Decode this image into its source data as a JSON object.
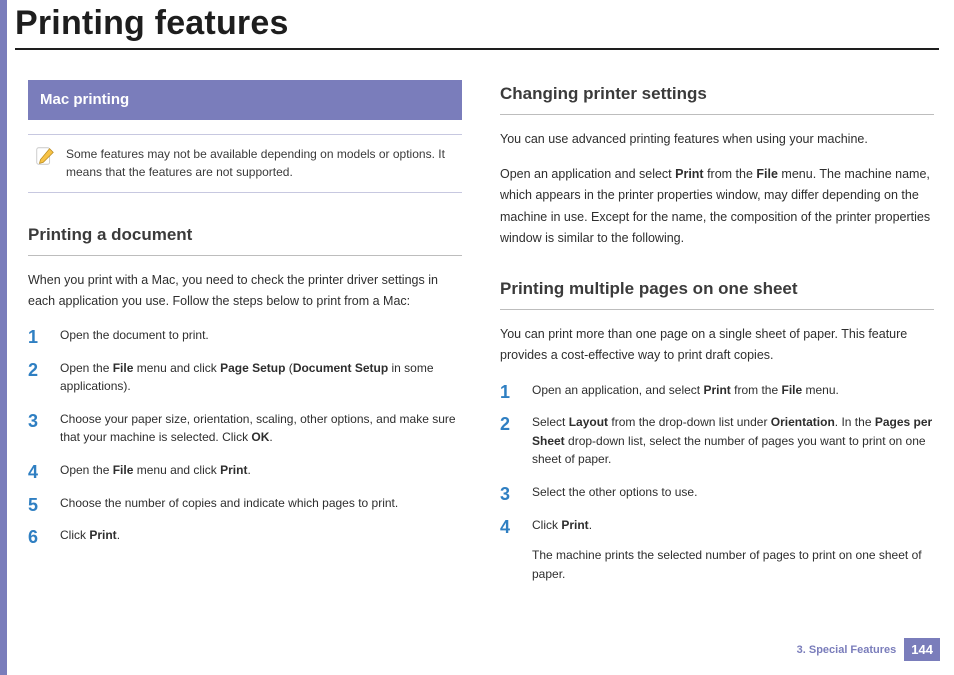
{
  "title": "Printing features",
  "left": {
    "banner": "Mac printing",
    "note": "Some features may not be available depending on models or options. It means that the features are not supported.",
    "subhead": "Printing a document",
    "intro": "When you print with a Mac, you need to check the printer driver settings in each application you use. Follow the steps below to print from a Mac:",
    "steps": {
      "s1": "Open the document to print.",
      "s2_pre": "Open the ",
      "s2_b1": "File",
      "s2_mid": " menu and click ",
      "s2_b2": "Page Setup",
      "s2_paren_open": " (",
      "s2_b3": "Document Setup",
      "s2_tail": " in some applications).",
      "s3_pre": "Choose your paper size, orientation, scaling, other options, and make sure that your machine is selected. Click ",
      "s3_b1": "OK",
      "s3_tail": ".",
      "s4_pre": "Open the ",
      "s4_b1": "File",
      "s4_mid": " menu and click ",
      "s4_b2": "Print",
      "s4_tail": ".",
      "s5": "Choose the number of copies and indicate which pages to print.",
      "s6_pre": "Click ",
      "s6_b1": "Print",
      "s6_tail": "."
    }
  },
  "right": {
    "subhead1": "Changing printer settings",
    "p1": "You can use advanced printing features when using your machine.",
    "p2_pre": "Open an application and select ",
    "p2_b1": "Print",
    "p2_mid": " from the ",
    "p2_b2": "File",
    "p2_tail": " menu. The machine name, which appears in the printer properties window, may differ depending on the machine in use. Except for the name, the composition of the printer properties window is similar to the following.",
    "subhead2": "Printing multiple pages on one sheet",
    "p3": "You can print more than one page on a single sheet of paper. This feature provides a cost-effective way to print draft copies.",
    "steps": {
      "s1_pre": "Open an application, and select ",
      "s1_b1": "Print",
      "s1_mid": " from the ",
      "s1_b2": "File",
      "s1_tail": " menu.",
      "s2_pre": "Select ",
      "s2_b1": "Layout",
      "s2_mid1": " from the drop-down list under ",
      "s2_b2": "Orientation",
      "s2_mid2": ". In the ",
      "s2_b3": "Pages per Sheet",
      "s2_tail": " drop-down list, select the number of pages you want to print on one sheet of paper.",
      "s3": "Select the other options to use.",
      "s4_pre": "Click ",
      "s4_b1": "Print",
      "s4_tail": ".",
      "s4_after": "The machine prints the selected number of pages to print on one sheet of paper."
    }
  },
  "footer": {
    "chapter": "3.  Special Features",
    "page": "144"
  }
}
